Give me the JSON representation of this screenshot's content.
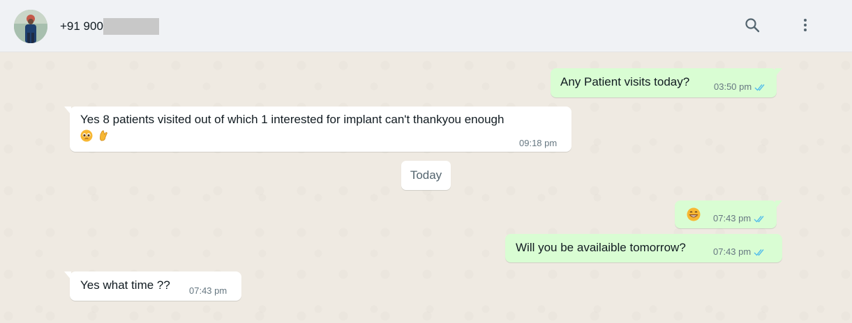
{
  "header": {
    "contact_name": "+91 900",
    "search_icon": "search-icon",
    "menu_icon": "kebab-menu-icon"
  },
  "colors": {
    "outgoing_bubble": "#d9fdd3",
    "incoming_bubble": "#ffffff",
    "read_ticks": "#53bdeb",
    "chat_background": "#efeae2"
  },
  "messages": [
    {
      "direction": "out",
      "text": "Any Patient visits today?",
      "time": "03:50 pm",
      "status": "read"
    },
    {
      "direction": "in",
      "text": "Yes 8 patients visited out of which 1 interested for implant can't thankyou enough",
      "emojis": [
        "pleading-face",
        "crossed-fingers"
      ],
      "time": "09:18 pm"
    },
    {
      "direction": "out",
      "text": "",
      "emojis": [
        "grinning-face"
      ],
      "time": "07:43 pm",
      "status": "read"
    },
    {
      "direction": "out",
      "text": "Will you be availaible tomorrow?",
      "time": "07:43 pm",
      "status": "read"
    },
    {
      "direction": "in",
      "text": "Yes what time ??",
      "time": "07:43 pm"
    }
  ],
  "date_divider": "Today"
}
